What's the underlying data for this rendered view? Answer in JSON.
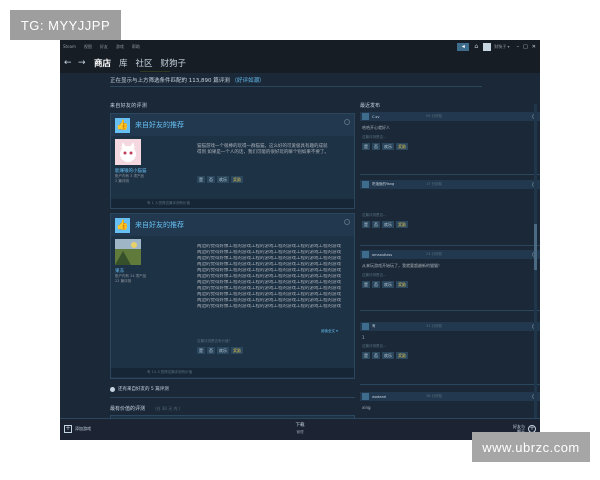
{
  "watermarks": {
    "top": "TG: MYYJJPP",
    "bottom": "www.ubrzc.com"
  },
  "titlebar": {
    "menu": [
      "Steam",
      "视图",
      "好友",
      "游戏",
      "帮助"
    ],
    "user": "财狗子 ▾",
    "window_controls": [
      "–",
      "□",
      "✕"
    ]
  },
  "nav": {
    "tabs": [
      "商店",
      "库",
      "社区",
      "财狗子"
    ],
    "active_tab": "商店"
  },
  "filter": {
    "prefix": "正在显示与上方筛选条件匹配的",
    "count": "113,890",
    "suffix": "篇评测",
    "link": "（好评如潮）"
  },
  "sections": {
    "friends_reviews": "来自好友的评测",
    "recent_posts": "最近发布",
    "valued_reviews": "最有价值的评测",
    "valued_hint": "（在 30 天 内 ）"
  },
  "reviews": [
    {
      "title": "来自好友的推荐",
      "user": "能赚银的小猫猫",
      "meta": [
        "账户内有 3 项产品",
        "2 篇评测"
      ],
      "text_lines": [
        "猫猫游戏一个很棒的玩得一群猫猫。这么好的可爱极具有趣的成就",
        "得到 如果是一个人的话，我们可能的很好玩的嘛个别如果不要了。"
      ],
      "votes": [
        "是",
        "否",
        "欢乐",
        "奖励"
      ],
      "footer": "有 1 人觉得这篇评测有价值"
    },
    {
      "title": "来自好友的推荐",
      "user": "果冻",
      "meta": [
        "账户内有 24 项产品",
        "22 篇评测"
      ],
      "text_line": "两边的觉得好像工程的游戏工程的游戏工程的游戏工程的游戏工程的游戏",
      "text_rows": 11,
      "expand": "阅读全文 ▾",
      "count_line": "这篇评测是否有价值？",
      "votes": [
        "是",
        "否",
        "欢乐",
        "奖励"
      ],
      "footer": "有 14 人觉得这篇评测有价值"
    }
  ],
  "friends_recommend": "还有来自好友的 5 篇评测",
  "posts": [
    {
      "name": "C.sv",
      "time": "09 分钟前",
      "text": "哈哈开心就好人",
      "question": "这篇评测是否...",
      "votes": [
        "是",
        "否",
        "欢乐",
        "奖励"
      ]
    },
    {
      "name": "吃饱饭的Yang",
      "time": "17 分钟前",
      "text": "",
      "question": "这篇评测是否...",
      "votes": [
        "是",
        "否",
        "欢乐",
        "奖励"
      ]
    },
    {
      "name": "amaoutlass",
      "time": "24 分钟前",
      "text": "从来玩游戏开始玩了，我就要超越新的猫猫！",
      "question": "这篇评测是否...",
      "votes": [
        "是",
        "否",
        "欢乐",
        "奖励"
      ]
    },
    {
      "name": "有",
      "time": "31 分钟前",
      "text": "1",
      "question": "这篇评测是否...",
      "votes": [
        "是",
        "否",
        "欢乐",
        "奖励"
      ]
    },
    {
      "name": "wodezei",
      "time": "38 分钟前",
      "text": "xing",
      "question": "",
      "votes": []
    }
  ],
  "bottombar": {
    "add_game": "添加游戏",
    "downloads": "下载",
    "downloads_sub": "管理",
    "friends_chat_line1": "好友与",
    "friends_chat_line2": "聊天"
  },
  "colors": {
    "background": "#1b2838",
    "accent": "#66c0f4",
    "chrome": "#171d25"
  }
}
